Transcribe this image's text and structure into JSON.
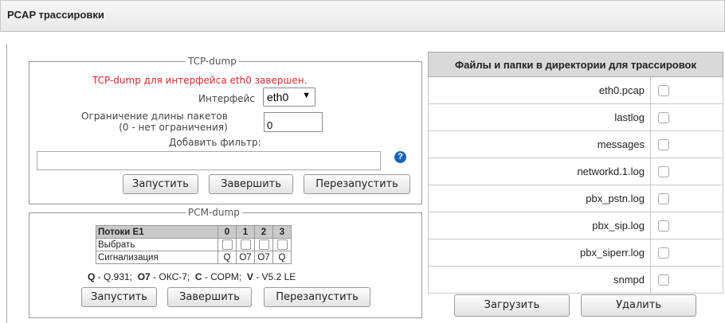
{
  "panel": {
    "title": "PCAP трассировки"
  },
  "tcp": {
    "legend": "TCP-dump",
    "status": "TCP-dump для интерфейса eth0 завершен.",
    "interface_label": "Интерфейс",
    "interface_value": "eth0",
    "limit_label_line1": "Ограничение длины пакетов",
    "limit_label_line2": "(0 - нет ограничения)",
    "limit_value": "0",
    "filter_label": "Добавить фильтр:",
    "filter_value": "",
    "help_glyph": "?",
    "buttons": {
      "start": "Запустить",
      "stop": "Завершить",
      "restart": "Перезапустить"
    }
  },
  "pcm": {
    "legend": "PCM-dump",
    "table": {
      "header": [
        "Потоки E1",
        "0",
        "1",
        "2",
        "3"
      ],
      "select_label": "Выбрать",
      "signaling_label": "Сигнализация",
      "signaling": [
        "Q",
        "O7",
        "O7",
        "Q"
      ]
    },
    "legend_text": {
      "q_key": "Q",
      "q_val": " - Q.931;  ",
      "o7_key": "O7",
      "o7_val": " - ОКС-7;  ",
      "c_key": "C",
      "c_val": " - СОРМ;  ",
      "v_key": "V",
      "v_val": " - V5.2 LE"
    },
    "buttons": {
      "start": "Запустить",
      "stop": "Завершить",
      "restart": "Перезапустить"
    }
  },
  "files": {
    "header": "Файлы и папки в директории для трассировок",
    "items": [
      "eth0.pcap",
      "lastlog",
      "messages",
      "networkd.1.log",
      "pbx_pstn.log",
      "pbx_sip.log",
      "pbx_siperr.log",
      "snmpd"
    ],
    "buttons": {
      "download": "Загрузить",
      "delete": "Удалить"
    }
  },
  "colors": {
    "status_red": "#e5262c",
    "help_blue": "#1b63b8",
    "header_gray": "#d9d9d9"
  }
}
